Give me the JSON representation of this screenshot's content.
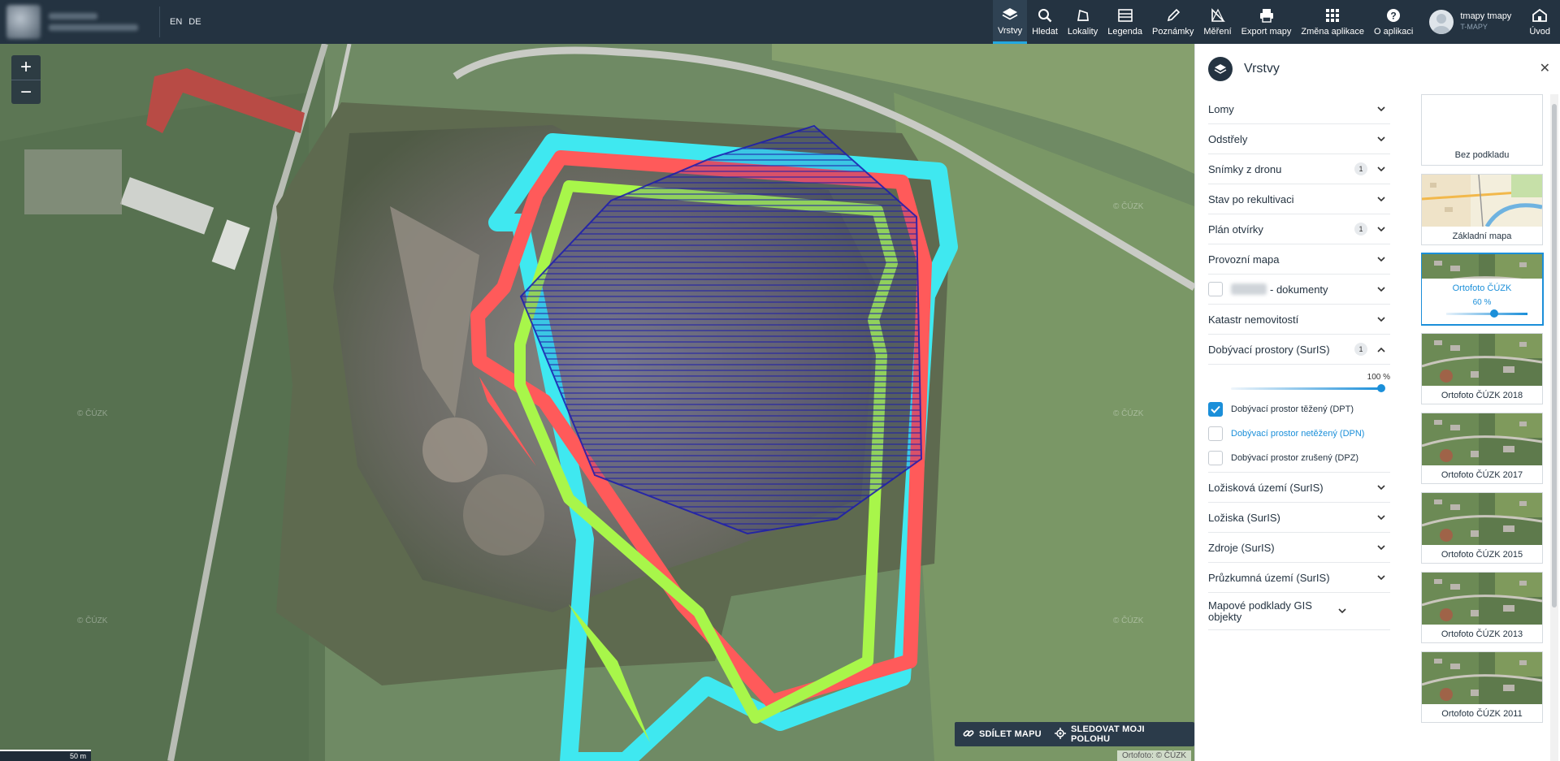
{
  "lang": {
    "en": "EN",
    "de": "DE"
  },
  "nav": [
    {
      "label": "Vrstvy",
      "icon": "layers-icon",
      "active": true
    },
    {
      "label": "Hledat",
      "icon": "search-icon"
    },
    {
      "label": "Lokality",
      "icon": "location-icon"
    },
    {
      "label": "Legenda",
      "icon": "legend-icon"
    },
    {
      "label": "Poznámky",
      "icon": "pencil-icon"
    },
    {
      "label": "Měření",
      "icon": "ruler-icon"
    },
    {
      "label": "Export mapy",
      "icon": "printer-icon"
    },
    {
      "label": "Změna aplikace",
      "icon": "grid-icon"
    },
    {
      "label": "O aplikaci",
      "icon": "help-icon"
    }
  ],
  "user": {
    "name": "tmapy tmapy",
    "sub": "T-MAPY"
  },
  "home": {
    "label": "Úvod",
    "icon": "home-icon"
  },
  "map": {
    "share_label": "SDÍLET MAPU",
    "track_label": "SLEDOVAT MOJI POLOHU",
    "scale_label": "50 m",
    "attribution": "Ortofoto: © ČÚZK",
    "watermark": "© ČÚZK"
  },
  "sidebar": {
    "title": "Vrstvy",
    "layers": [
      {
        "label": "Lomy"
      },
      {
        "label": "Odstřely"
      },
      {
        "label": "Snímky z dronu",
        "badge": "1"
      },
      {
        "label": "Stav po rekultivaci"
      },
      {
        "label": "Plán otvírky",
        "badge": "1"
      },
      {
        "label": "Provozní mapa"
      },
      {
        "label": "- dokumenty",
        "checkbox": true
      },
      {
        "label": "Katastr nemovitostí"
      },
      {
        "label": "Dobývací prostory (SurIS)",
        "badge": "1",
        "expanded": true
      }
    ],
    "expanded": {
      "opacity": "100 %",
      "items": [
        {
          "label": "Dobývací prostor těžený (DPT)",
          "checked": true
        },
        {
          "label": "Dobývací prostor netěžený (DPN)",
          "checked": false,
          "highlight": true
        },
        {
          "label": "Dobývací prostor zrušený (DPZ)",
          "checked": false
        }
      ]
    },
    "layers_after": [
      {
        "label": "Ložisková území (SurIS)"
      },
      {
        "label": "Ložiska (SurIS)"
      },
      {
        "label": "Zdroje (SurIS)"
      },
      {
        "label": "Průzkumná území (SurIS)"
      },
      {
        "label": "Mapové podklady GIS objekty"
      }
    ],
    "basemaps": [
      {
        "label": "Bez podkladu",
        "type": "empty"
      },
      {
        "label": "Základní mapa",
        "type": "map"
      },
      {
        "label": "Ortofoto ČÚZK",
        "type": "ortho",
        "active": true,
        "opacity": "60 %"
      },
      {
        "label": "Ortofoto ČÚZK 2018",
        "type": "ortho"
      },
      {
        "label": "Ortofoto ČÚZK 2017",
        "type": "ortho"
      },
      {
        "label": "Ortofoto ČÚZK 2015",
        "type": "ortho"
      },
      {
        "label": "Ortofoto ČÚZK 2013",
        "type": "ortho"
      },
      {
        "label": "Ortofoto ČÚZK 2011",
        "type": "ortho"
      }
    ]
  }
}
